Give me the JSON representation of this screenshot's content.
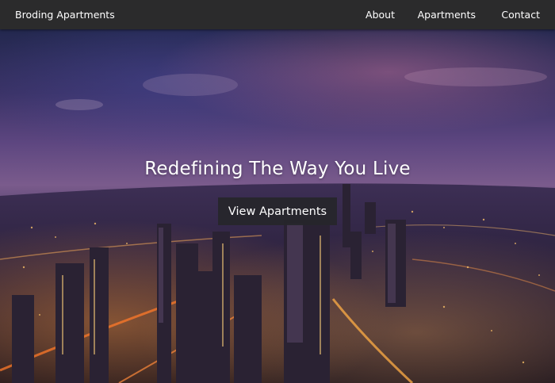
{
  "nav": {
    "brand": "Broding Apartments",
    "links": [
      "About",
      "Apartments",
      "Contact"
    ]
  },
  "hero": {
    "headline": "Redefining The Way You Live",
    "cta_label": "View Apartments"
  },
  "colors": {
    "nav_background": "#2b2b2c",
    "button_background": "#26262a",
    "text": "#ffffff"
  }
}
